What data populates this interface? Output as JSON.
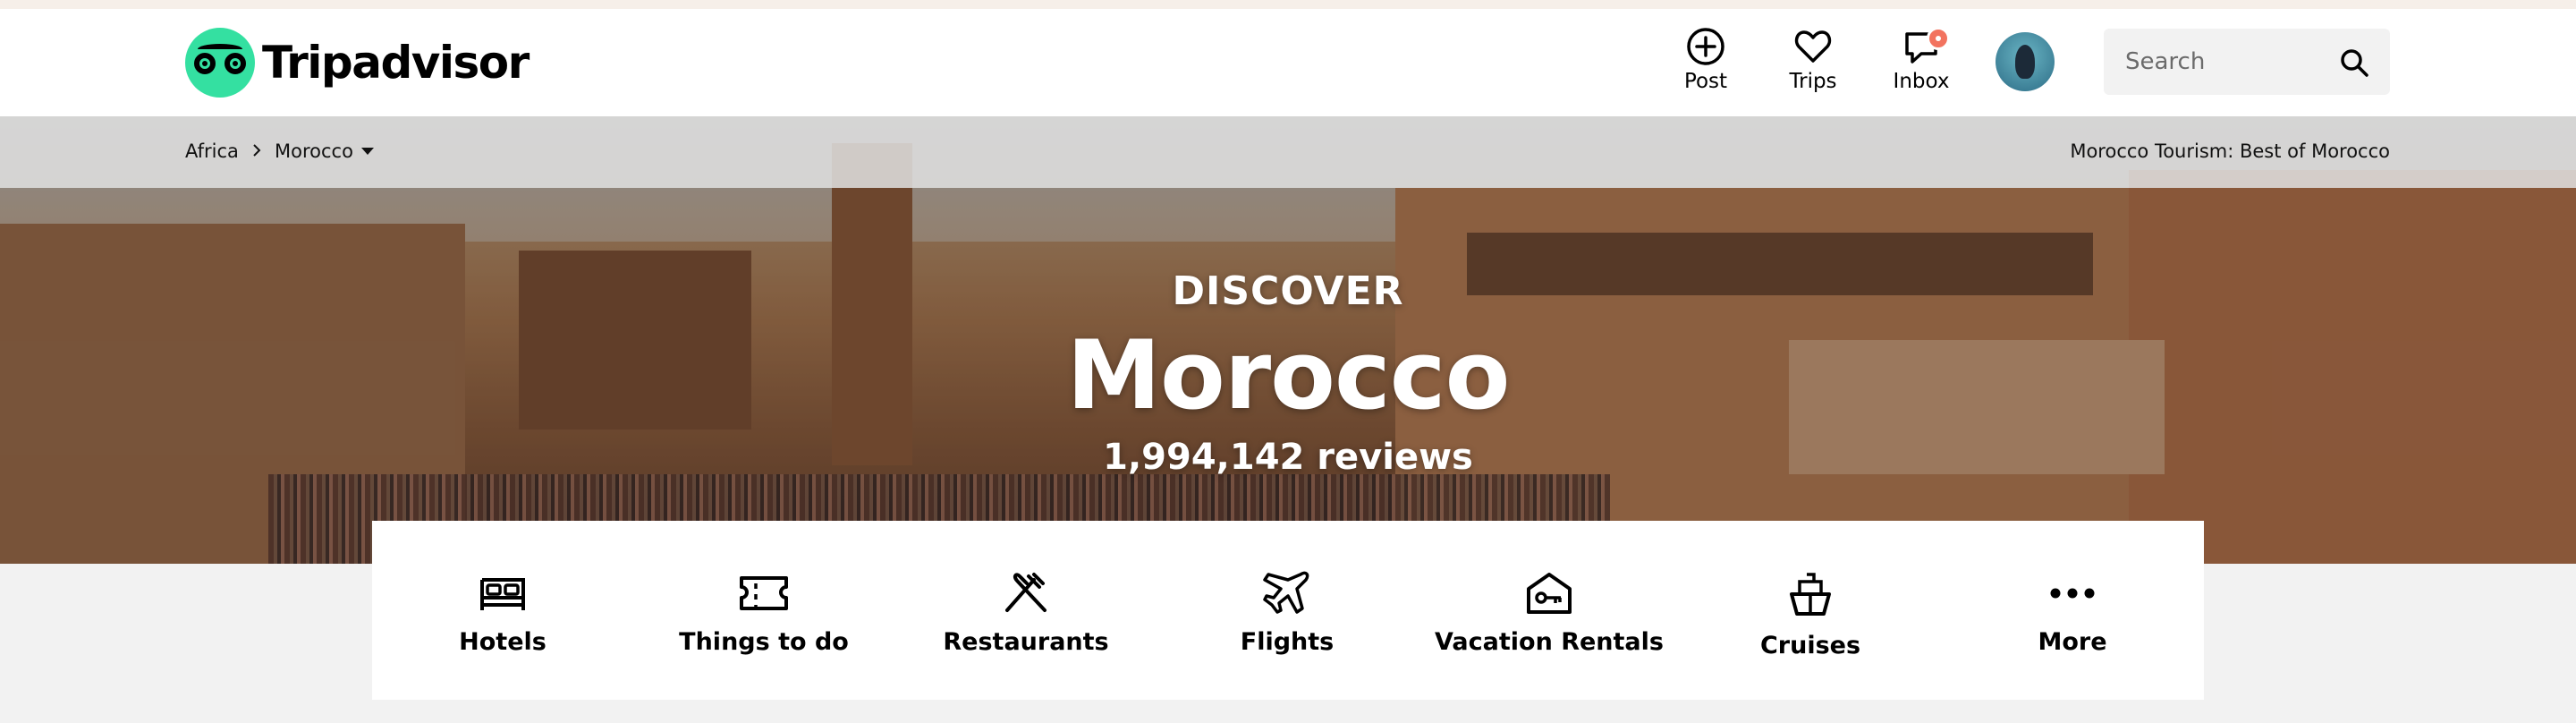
{
  "brand": {
    "name": "Tripadvisor",
    "accent": "#34e0a1"
  },
  "header_nav": [
    {
      "label": "Post",
      "icon": "plus-circle-icon"
    },
    {
      "label": "Trips",
      "icon": "heart-icon"
    },
    {
      "label": "Inbox",
      "icon": "chat-bubble-icon",
      "badge_color": "#f2735f"
    }
  ],
  "search": {
    "placeholder": "Search"
  },
  "breadcrumb": {
    "items": [
      "Africa",
      "Morocco"
    ],
    "right_link": "Morocco Tourism: Best of Morocco"
  },
  "hero": {
    "kicker": "DISCOVER",
    "title": "Morocco",
    "reviews": "1,994,142 reviews"
  },
  "categories": [
    {
      "label": "Hotels",
      "icon": "bed-icon"
    },
    {
      "label": "Things to do",
      "icon": "ticket-icon"
    },
    {
      "label": "Restaurants",
      "icon": "fork-knife-icon"
    },
    {
      "label": "Flights",
      "icon": "airplane-icon"
    },
    {
      "label": "Vacation Rentals",
      "icon": "house-key-icon"
    },
    {
      "label": "Cruises",
      "icon": "ship-icon"
    },
    {
      "label": "More",
      "icon": "more-dots-icon"
    }
  ]
}
